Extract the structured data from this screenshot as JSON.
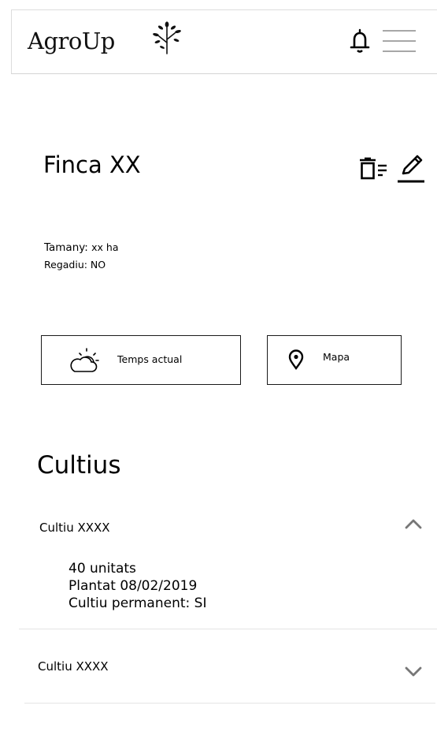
{
  "header": {
    "logo_text": "AgroUp",
    "logo_icon": "sprout-icon",
    "notification_icon": "bell-icon",
    "menu_icon": "hamburger-menu-icon"
  },
  "farm": {
    "title": "Finca XX",
    "size_label": "Tamany: ",
    "size_value": "xx ha",
    "irrigation": "Regadiu: NO"
  },
  "actions": {
    "weather_label": "Temps actual",
    "weather_icon": "partly-cloudy-sun-icon",
    "map_label": "Mapa",
    "map_icon": "map-pin-icon",
    "delete_icon": "trash-list-icon",
    "edit_icon": "pencil-icon"
  },
  "crops": {
    "title": "Cultius",
    "items": [
      {
        "name": "Cultiu XXXX",
        "expanded": true,
        "details": [
          "40 unitats",
          "Plantat 08/02/2019",
          "Cultiu permanent: SI"
        ]
      },
      {
        "name": "Cultiu XXXX",
        "expanded": false
      }
    ]
  },
  "colors": {
    "text": "#000000",
    "divider": "#e4e4e4",
    "chevron": "#777777"
  }
}
